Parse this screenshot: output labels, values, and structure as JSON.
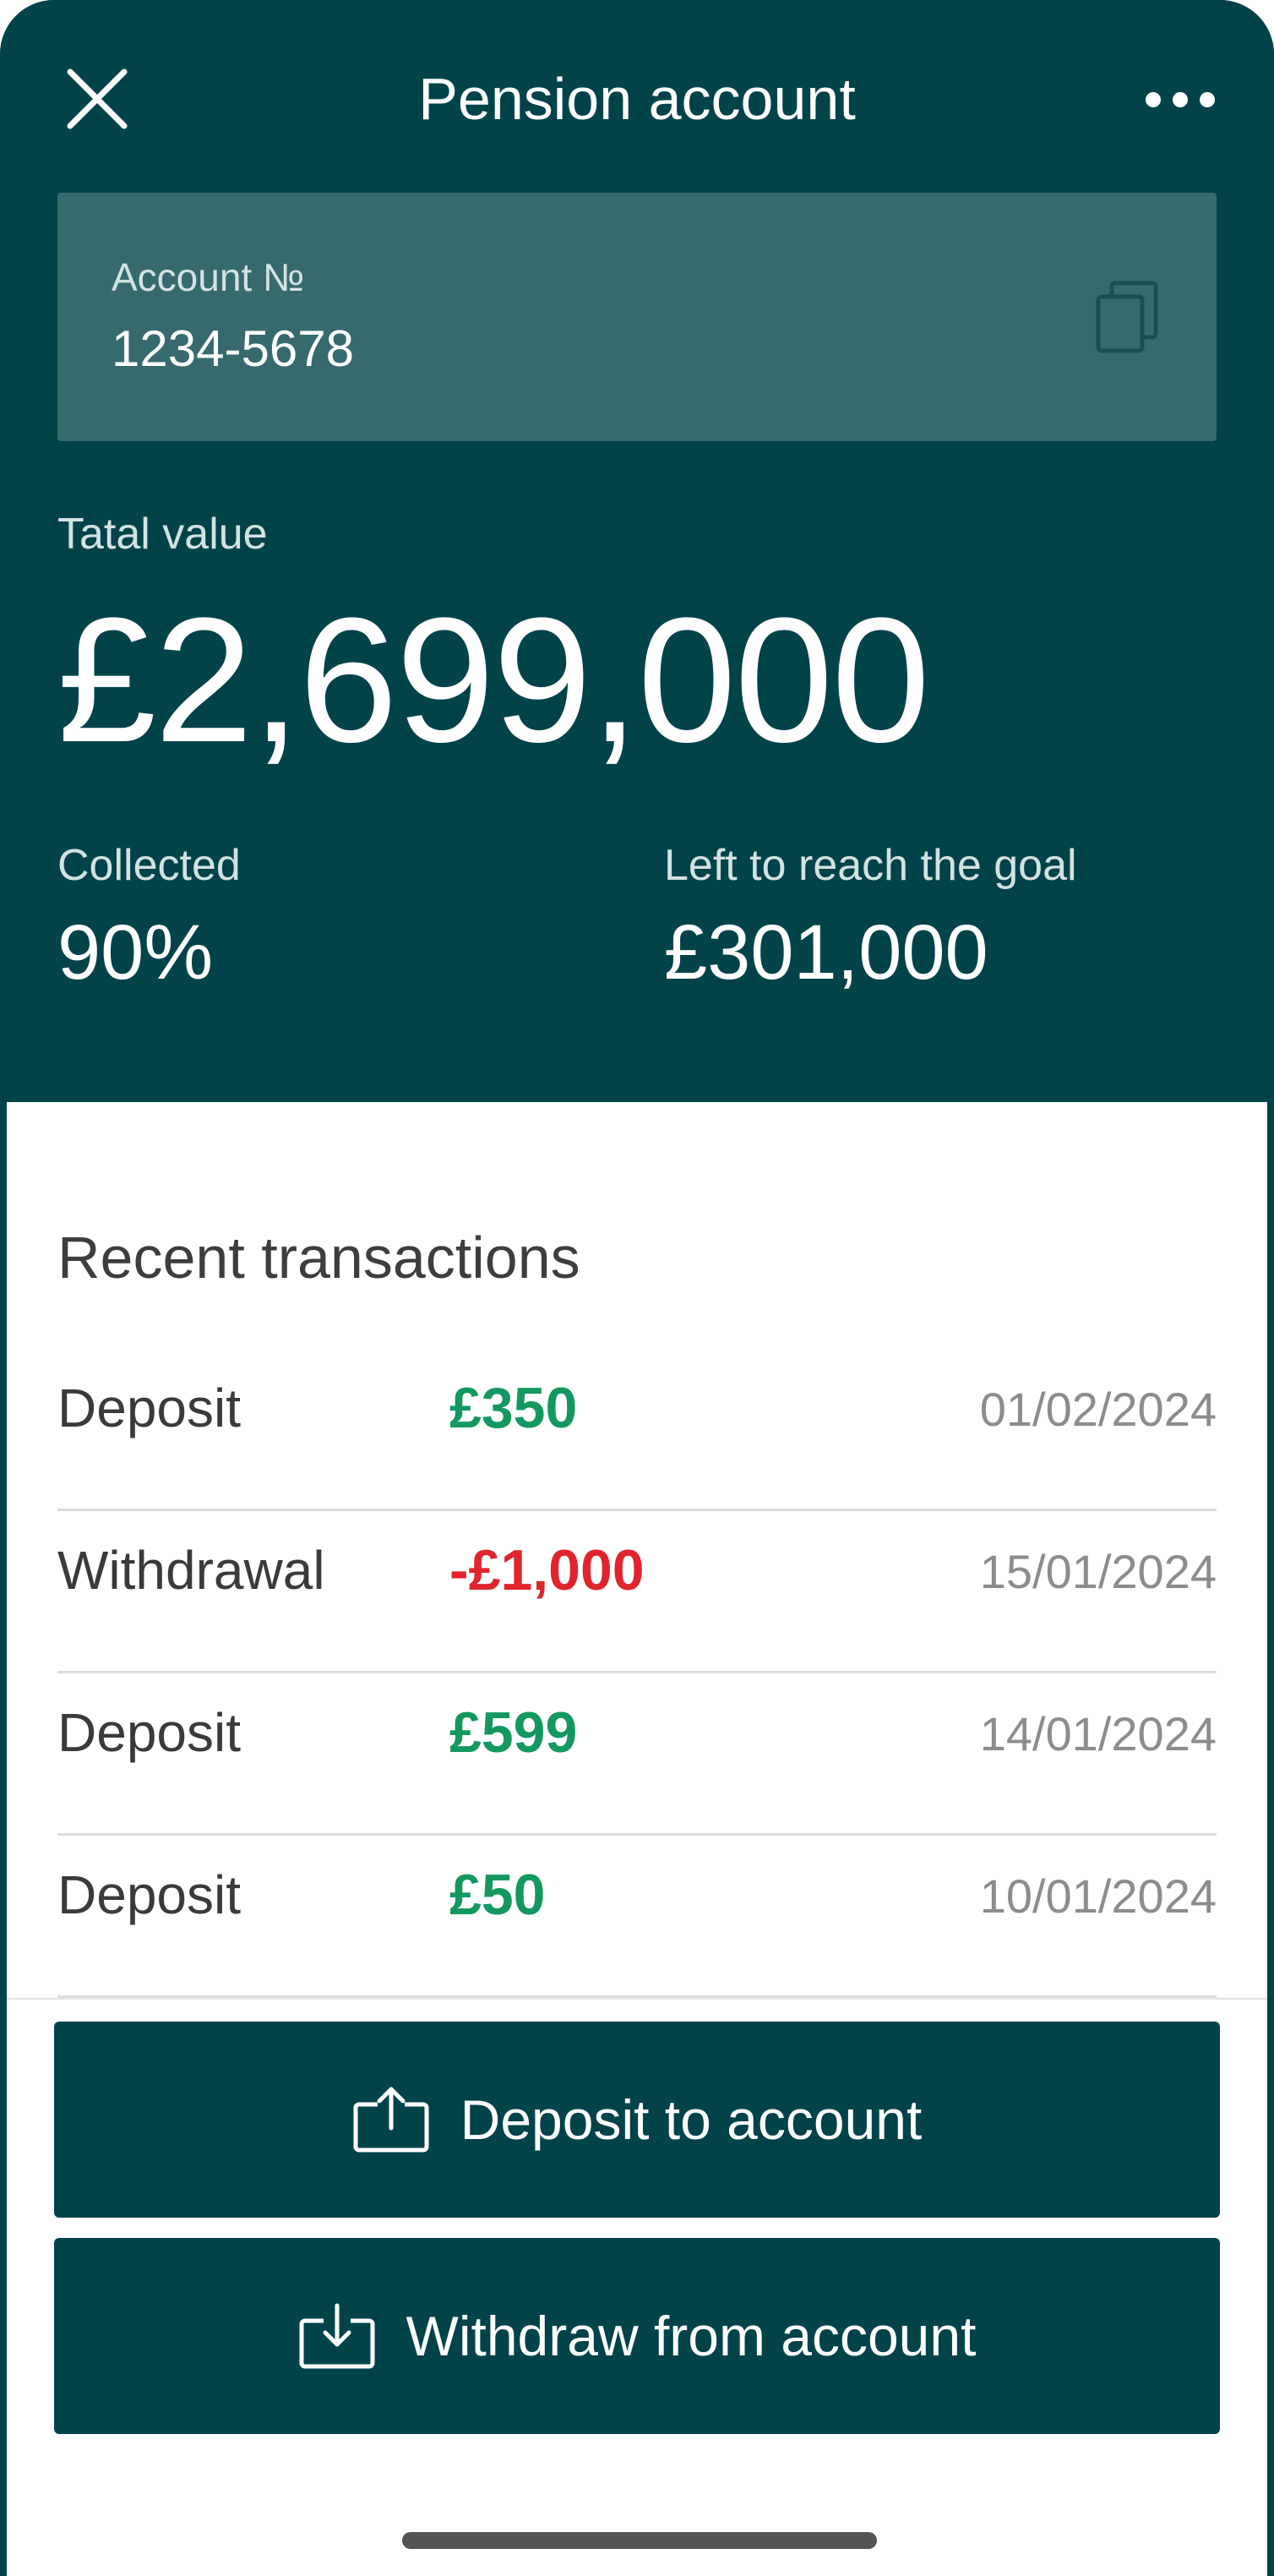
{
  "header": {
    "title": "Pension account",
    "close_icon": "close-icon",
    "more_icon": "more-horizontal-icon"
  },
  "account": {
    "label": "Account №",
    "number": "1234-5678",
    "copy_icon": "copy-icon"
  },
  "summary": {
    "total_label": "Tatal value",
    "total_value": "£2,699,000",
    "collected_label": "Collected",
    "collected_value": "90%",
    "left_label": "Left to reach the goal",
    "left_value": "£301,000"
  },
  "transactions": {
    "title": "Recent transactions",
    "items": [
      {
        "type": "Deposit",
        "amount": "£350",
        "date": "01/02/2024",
        "direction": "in"
      },
      {
        "type": "Withdrawal",
        "amount": "-£1,000",
        "date": "15/01/2024",
        "direction": "out"
      },
      {
        "type": "Deposit",
        "amount": "£599",
        "date": "14/01/2024",
        "direction": "in"
      },
      {
        "type": "Deposit",
        "amount": "£50",
        "date": "10/01/2024",
        "direction": "in"
      }
    ]
  },
  "actions": {
    "deposit_label": "Deposit to account",
    "deposit_icon": "upload-icon",
    "withdraw_label": "Withdraw from account",
    "withdraw_icon": "download-icon"
  },
  "colors": {
    "primary": "#02434a",
    "card": "#366a6f",
    "positive": "#139860",
    "negative": "#e0242e"
  }
}
